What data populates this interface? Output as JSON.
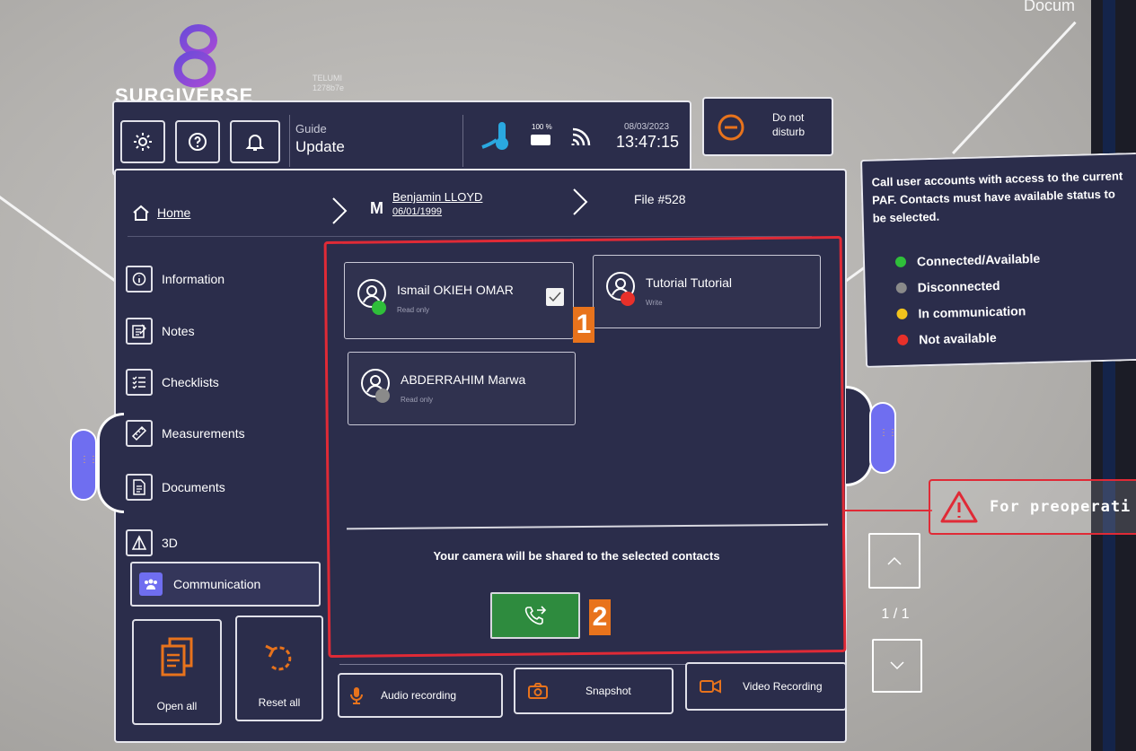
{
  "brand": {
    "name": "SURGIVERSE",
    "sub_line1": "TELUMI",
    "sub_line2": "1278b7e"
  },
  "topbar": {
    "guide_label": "Guide",
    "guide_value": "Update",
    "battery_pct": "100 %",
    "date": "08/03/2023",
    "time": "13:47:15"
  },
  "dnd": {
    "label_line1": "Do not",
    "label_line2": "disturb"
  },
  "breadcrumb": {
    "home": "Home",
    "patient_initial": "M",
    "patient_name": "Benjamin LLOYD",
    "patient_dob": "06/01/1999",
    "file": "File #528"
  },
  "sidebar": {
    "items": [
      {
        "label": "Information"
      },
      {
        "label": "Notes"
      },
      {
        "label": "Checklists"
      },
      {
        "label": "Measurements"
      },
      {
        "label": "Documents"
      },
      {
        "label": "3D"
      },
      {
        "label": "Communication"
      }
    ],
    "open_all": "Open all",
    "reset_all": "Reset all"
  },
  "contacts": [
    {
      "name": "Ismail OKIEH OMAR",
      "role": "Read only",
      "status": "connected",
      "status_color": "#2fbf3a",
      "selected": true
    },
    {
      "name": "Tutorial Tutorial",
      "role": "Write",
      "status": "not-available",
      "status_color": "#e8302a",
      "selected": false
    },
    {
      "name": "ABDERRAHIM Marwa",
      "role": "Read only",
      "status": "disconnected",
      "status_color": "#8a8a8a",
      "selected": false
    }
  ],
  "camera_notice": "Your camera will be shared to the selected contacts",
  "call_button_icon": "phone-forward-icon",
  "bottom_buttons": {
    "audio": "Audio recording",
    "snapshot": "Snapshot",
    "video": "Video Recording"
  },
  "pager": {
    "text": "1 / 1"
  },
  "tooltip": {
    "text": "Call user accounts with access to the current PAF. Contacts must have available status to be selected.",
    "legend": [
      {
        "label": "Connected/Available",
        "color": "#2fbf3a"
      },
      {
        "label": "Disconnected",
        "color": "#8a8a8a"
      },
      {
        "label": "In communication",
        "color": "#f2c31c"
      },
      {
        "label": "Not available",
        "color": "#e8302a"
      }
    ]
  },
  "warning": {
    "text": "For preoperati"
  },
  "top_right_text": "Docum",
  "annotations": {
    "badge1": "1",
    "badge2": "2"
  },
  "colors": {
    "panel": "#2b2d4b",
    "accent_purple": "#6f6ef0",
    "call_green": "#2e8b3e",
    "highlight_red": "#e02a36",
    "orange_icon": "#e8731c",
    "badge_orange": "#e8731c"
  }
}
